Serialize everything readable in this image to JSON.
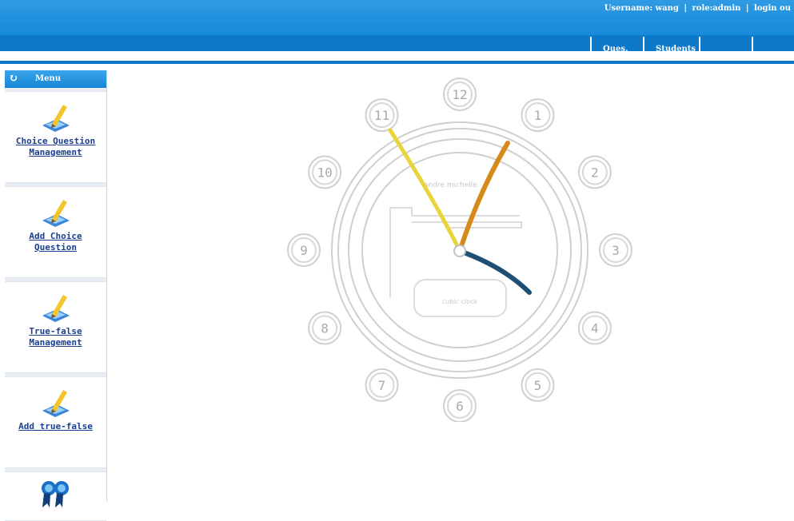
{
  "header": {
    "username_text": "Username: wang",
    "role_text": "role:admin",
    "logout_text": "login ou",
    "separator": "|"
  },
  "nav": {
    "tabs": [
      "Ques.",
      "Students",
      "",
      ""
    ]
  },
  "sidebar": {
    "menu_title": "Menu",
    "items": [
      {
        "line1": "Choice Question",
        "line2": "Management",
        "icon": "pencil-paper-icon"
      },
      {
        "line1": "Add Choice",
        "line2": "Question",
        "icon": "pencil-paper-icon"
      },
      {
        "line1": "True-false",
        "line2": "Management",
        "icon": "pencil-paper-icon"
      },
      {
        "line1": "Add true-false",
        "line2": "",
        "icon": "pencil-paper-icon"
      },
      {
        "line1": "",
        "line2": "",
        "icon": "award-ribbon-icon"
      }
    ]
  },
  "clock": {
    "numbers": [
      "12",
      "1",
      "2",
      "3",
      "4",
      "5",
      "6",
      "7",
      "8",
      "9",
      "10",
      "11"
    ],
    "brand_text": "andre michelle",
    "badge_text": "cubic clock",
    "hour_hand_color": "#1d4f74",
    "minute_hand_color": "#d58a1a",
    "second_hand_color": "#e7d53a"
  }
}
